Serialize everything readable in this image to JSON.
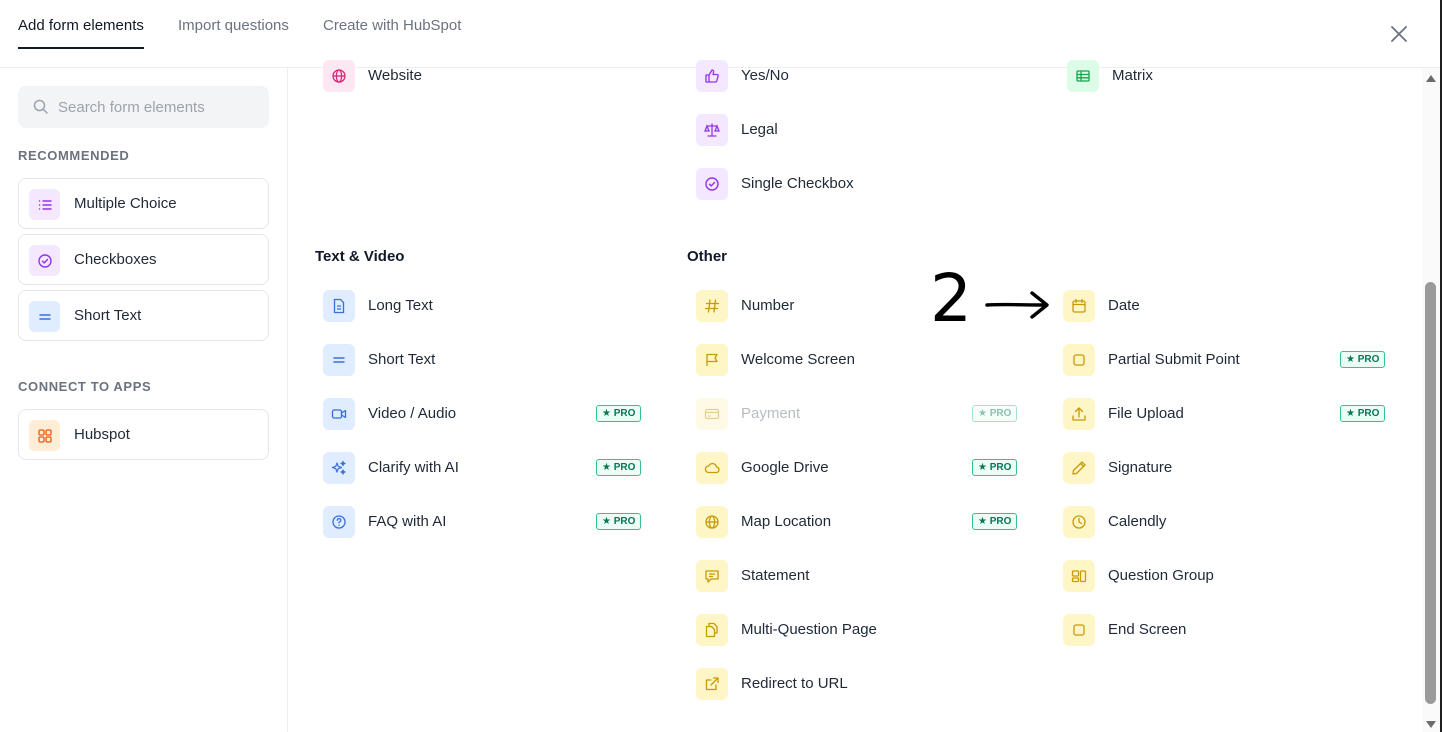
{
  "tabs": [
    {
      "label": "Add form elements",
      "active": true
    },
    {
      "label": "Import questions",
      "active": false
    },
    {
      "label": "Create with HubSpot",
      "active": false
    }
  ],
  "sidebar": {
    "search_placeholder": "Search form elements",
    "recommended_title": "RECOMMENDED",
    "recommended": [
      {
        "label": "Multiple Choice",
        "icon": "list-icon"
      },
      {
        "label": "Checkboxes",
        "icon": "check-circle-icon"
      },
      {
        "label": "Short Text",
        "icon": "equals-icon"
      }
    ],
    "connect_title": "CONNECT TO APPS",
    "apps": [
      {
        "label": "Hubspot",
        "icon": "grid-icon"
      }
    ]
  },
  "main": {
    "top_items": {
      "col1": [
        {
          "label": "Website",
          "icon": "globe-icon"
        }
      ],
      "col2": [
        {
          "label": "Yes/No",
          "icon": "thumbs-up-icon"
        },
        {
          "label": "Legal",
          "icon": "scale-icon"
        },
        {
          "label": "Single Checkbox",
          "icon": "check-circle-icon"
        }
      ],
      "col3": [
        {
          "label": "Matrix",
          "icon": "table-icon"
        }
      ]
    },
    "text_video": {
      "heading": "Text & Video",
      "items": [
        {
          "label": "Long Text",
          "icon": "document-icon",
          "pro": false
        },
        {
          "label": "Short Text",
          "icon": "equals-icon",
          "pro": false
        },
        {
          "label": "Video / Audio",
          "icon": "video-icon",
          "pro": true
        },
        {
          "label": "Clarify with AI",
          "icon": "sparkle-icon",
          "pro": true
        },
        {
          "label": "FAQ with AI",
          "icon": "question-icon",
          "pro": true
        }
      ]
    },
    "other": {
      "heading": "Other",
      "col_a": [
        {
          "label": "Number",
          "icon": "hash-icon",
          "pro": false
        },
        {
          "label": "Welcome Screen",
          "icon": "flag-icon",
          "pro": false
        },
        {
          "label": "Payment",
          "icon": "card-icon",
          "pro": true,
          "disabled": true
        },
        {
          "label": "Google Drive",
          "icon": "cloud-icon",
          "pro": true
        },
        {
          "label": "Map Location",
          "icon": "globe-icon",
          "pro": true
        },
        {
          "label": "Statement",
          "icon": "message-icon",
          "pro": false
        },
        {
          "label": "Multi-Question Page",
          "icon": "pages-icon",
          "pro": false
        },
        {
          "label": "Redirect to URL",
          "icon": "external-link-icon",
          "pro": false
        }
      ],
      "col_b": [
        {
          "label": "Date",
          "icon": "calendar-icon",
          "pro": false
        },
        {
          "label": "Partial Submit Point",
          "icon": "square-icon",
          "pro": true
        },
        {
          "label": "File Upload",
          "icon": "upload-icon",
          "pro": true
        },
        {
          "label": "Signature",
          "icon": "pen-icon",
          "pro": false
        },
        {
          "label": "Calendly",
          "icon": "clock-icon",
          "pro": false
        },
        {
          "label": "Question Group",
          "icon": "group-icon",
          "pro": false
        },
        {
          "label": "End Screen",
          "icon": "square-icon",
          "pro": false
        }
      ]
    },
    "pro_label": "★ PRO"
  },
  "annotation": {
    "number": "2",
    "arrow": "→"
  },
  "colors": {
    "purple_bg": "#f3e8ff",
    "purple_fg": "#9333ea",
    "blue_bg": "#e0ecff",
    "blue_fg": "#3b6fd8",
    "yellow_bg": "#fef6c7",
    "yellow_fg": "#c99a06",
    "green_bg": "#dcfce7",
    "green_fg": "#16a34a",
    "pink_bg": "#fce7f3",
    "pink_fg": "#db2777",
    "orange_bg": "#ffedd5",
    "orange_fg": "#ea580c"
  }
}
